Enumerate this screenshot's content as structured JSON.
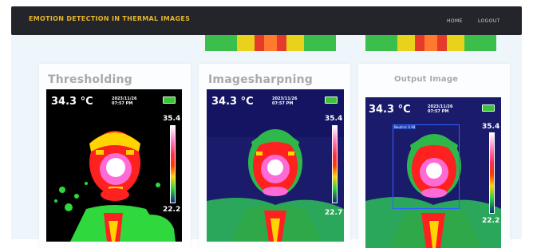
{
  "navbar": {
    "brand": "EMOTION DETECTION IN THERMAL IMAGES",
    "links": [
      {
        "label": "HOME"
      },
      {
        "label": "LOGOUT"
      }
    ]
  },
  "colors": {
    "navbar_bg": "#23252a",
    "brand_text": "#e7b52d",
    "nav_link_text": "#d0d0d0",
    "content_bg": "#eef5fb",
    "card_bg": "#fcfdfe",
    "card_title": "#a9a9a9"
  },
  "cards": [
    {
      "title": "Thresholding",
      "image": {
        "temperature": "34.3 °C",
        "date": "2023/11/26",
        "time": "07:57 PM",
        "scale_max": "35.4",
        "scale_min": "22.2"
      }
    },
    {
      "title": "Imagesharpning",
      "image": {
        "temperature": "34.3 °C",
        "date": "2023/11/26",
        "time": "07:57 PM",
        "scale_max": "35.4",
        "scale_min": "22.7"
      }
    },
    {
      "title": "Output Image",
      "image": {
        "temperature": "34.3 °C",
        "date": "2023/11/26",
        "time": "07:57 PM",
        "scale_max": "35.4",
        "scale_min": "22.2",
        "detection_label": "Neutral: 0.98"
      }
    }
  ]
}
